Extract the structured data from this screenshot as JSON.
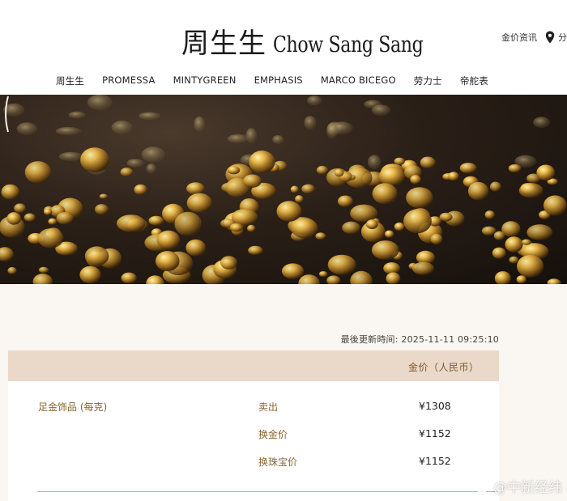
{
  "brand": {
    "cn": "周生生",
    "en": "Chow Sang Sang"
  },
  "utility": {
    "gold_info": "金价资讯",
    "share_label": "分"
  },
  "nav": [
    "周生生",
    "PROMESSA",
    "MINTYGREEN",
    "EMPHASIS",
    "MARCO BICEGO",
    "劳力士",
    "帝舵表"
  ],
  "updated_text": "最後更新時间: 2025-11-11 09:25:10",
  "table": {
    "header": "金价（人民币）",
    "product": "足金饰品 (每克)",
    "rows": [
      {
        "type": "卖出",
        "price": "¥1308"
      },
      {
        "type": "换金价",
        "price": "¥1152"
      },
      {
        "type": "换珠宝价",
        "price": "¥1152"
      }
    ]
  },
  "watermark": "@中新经纬",
  "colors": {
    "header_band": "#ead9c8",
    "label_gold": "#8a6535",
    "page_bg": "#faf6f1"
  }
}
